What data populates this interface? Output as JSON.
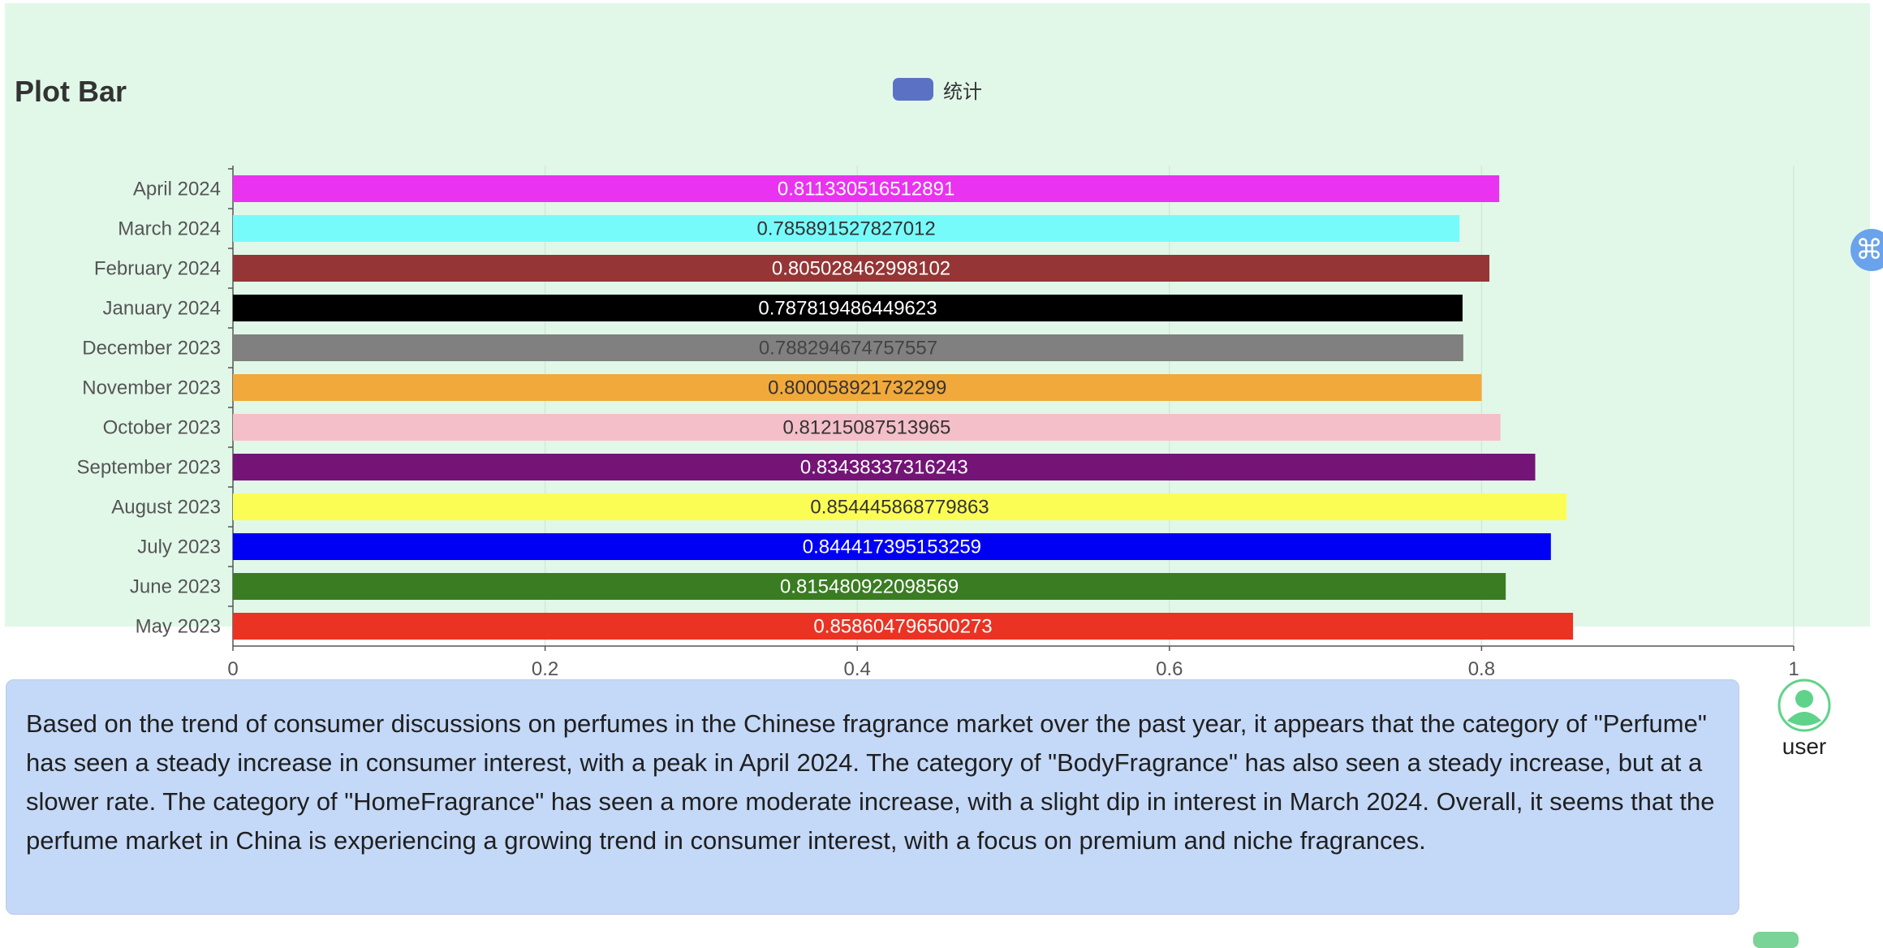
{
  "header": {
    "title": "Plot Bar"
  },
  "legend": {
    "label": "统计",
    "color": "#5b72c4"
  },
  "side_tool": {
    "icon": "command-icon",
    "glyph": "⌘"
  },
  "message": {
    "text": "Based on the trend of consumer discussions on perfumes in the Chinese fragrance market over the past year, it appears that the category of \"Perfume\" has seen a steady increase in consumer interest, with a peak in April 2024. The category of \"BodyFragrance\" has also seen a steady increase, but at a slower rate. The category of \"HomeFragrance\" has seen a more moderate increase, with a slight dip in interest in March 2024. Overall, it seems that the perfume market in China is experiencing a growing trend in consumer interest, with a focus on premium and niche fragrances."
  },
  "user": {
    "label": "user",
    "icon": "user-avatar-icon",
    "color": "#5fd38a"
  },
  "chart_data": {
    "type": "bar",
    "orientation": "horizontal",
    "title": "Plot Bar",
    "xlabel": "",
    "ylabel": "",
    "xlim": [
      0,
      1
    ],
    "x_ticks": [
      "0",
      "0.2",
      "0.4",
      "0.6",
      "0.8",
      "1"
    ],
    "grid": true,
    "legend_position": "top-center",
    "series": [
      {
        "name": "统计"
      }
    ],
    "categories": [
      "April 2024",
      "March 2024",
      "February 2024",
      "January 2024",
      "December 2023",
      "November 2023",
      "October 2023",
      "September 2023",
      "August 2023",
      "July 2023",
      "June 2023",
      "May 2023"
    ],
    "values": [
      0.811330516512891,
      0.785891527827012,
      0.805028462998102,
      0.787819486449623,
      0.788294674757557,
      0.800058921732299,
      0.81215087513965,
      0.83438337316243,
      0.854445868779863,
      0.844417395153259,
      0.815480922098569,
      0.858604796500273
    ],
    "value_labels": [
      "0.811330516512891",
      "0.785891527827012",
      "0.805028462998102",
      "0.787819486449623",
      "0.788294674757557",
      "0.800058921732299",
      "0.81215087513965",
      "0.83438337316243",
      "0.854445868779863",
      "0.844417395153259",
      "0.815480922098569",
      "0.858604796500273"
    ],
    "colors": [
      "#e933f0",
      "#76fbfa",
      "#953535",
      "#000000",
      "#808080",
      "#f2a93b",
      "#f4bfc9",
      "#741477",
      "#fcfd54",
      "#0000f5",
      "#3a7c22",
      "#ea3323"
    ],
    "label_colors": [
      "#ffffff",
      "#333333",
      "#ffffff",
      "#ffffff",
      "#444444",
      "#333333",
      "#333333",
      "#ffffff",
      "#333333",
      "#ffffff",
      "#ffffff",
      "#ffffff"
    ]
  }
}
